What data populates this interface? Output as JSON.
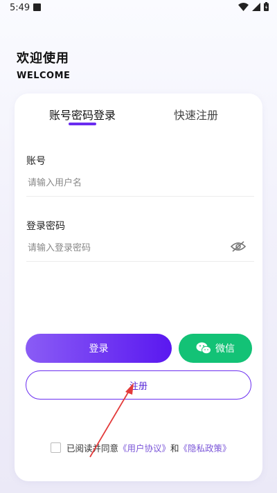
{
  "status_bar": {
    "time": "5:49"
  },
  "welcome": {
    "title": "欢迎使用",
    "subtitle": "WELCOME"
  },
  "tabs": [
    {
      "label": "账号密码登录",
      "active": true
    },
    {
      "label": "快速注册",
      "active": false
    }
  ],
  "form": {
    "account_label": "账号",
    "account_placeholder": "请输入用户名",
    "password_label": "登录密码",
    "password_placeholder": "请输入登录密码"
  },
  "buttons": {
    "login": "登录",
    "wechat": "微信",
    "register": "注册"
  },
  "agreement": {
    "prefix": "已阅读并同意",
    "user_agreement": "《用户协议》",
    "conjunction": "和",
    "privacy_policy": "《隐私政策》"
  },
  "colors": {
    "accent": "#6a2cf0",
    "wechat": "#13c276",
    "annotation_arrow": "#e33b3b"
  }
}
